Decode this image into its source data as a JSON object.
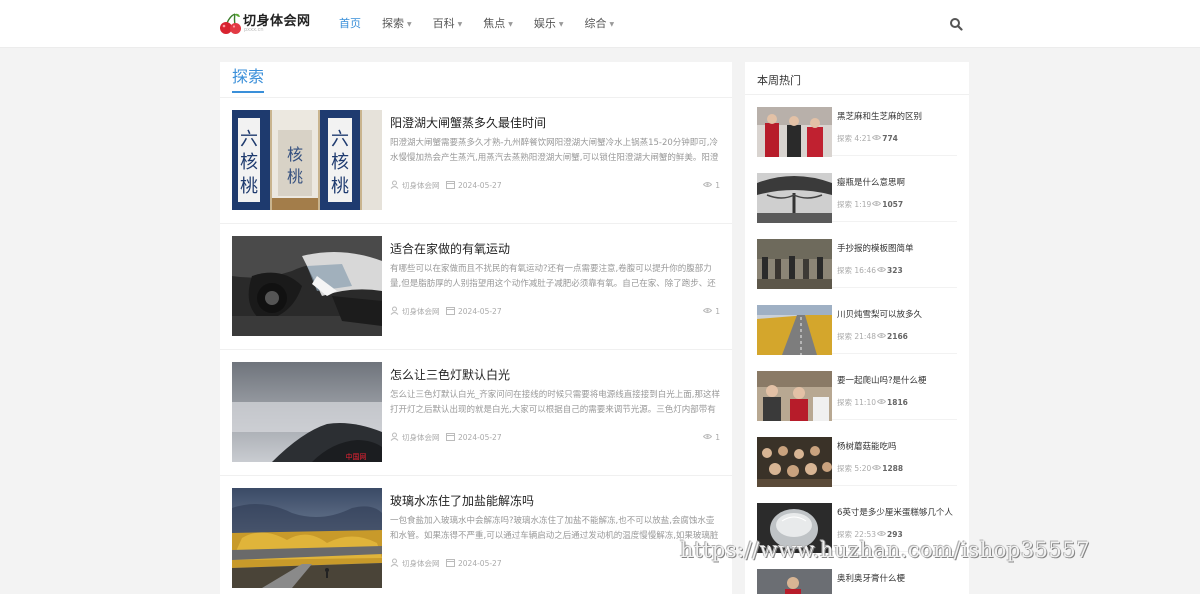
{
  "site": {
    "name": "切身体会网",
    "sub": "pxxx.cn"
  },
  "nav": {
    "items": [
      {
        "label": "首页",
        "active": true
      },
      {
        "label": "探索",
        "caret": true
      },
      {
        "label": "百科",
        "caret": true
      },
      {
        "label": "焦点",
        "caret": true
      },
      {
        "label": "娱乐",
        "caret": true
      },
      {
        "label": "综合",
        "caret": true
      }
    ],
    "search_icon": "search-icon"
  },
  "main": {
    "section_title": "探索",
    "posts": [
      {
        "title": "阳澄湖大闸蟹蒸多久最佳时间",
        "excerpt": "阳澄湖大闸蟹需要蒸多久才熟-九州醉餐饮网阳澄湖大闸蟹冷水上锅蒸15-20分钟即可,冷水慢慢加热会产生蒸汽,用蒸汽去蒸熟阳澄湖大闸蟹,可以锁住阳澄湖大闸蟹的鲜美。阳澄湖大闸蟹...",
        "author": "切身体会网",
        "date": "2024-05-27",
        "views": "1"
      },
      {
        "title": "适合在家做的有氧运动",
        "excerpt": "有哪些可以在家做而且不扰民的有氧运动?还有一点需要注意,卷腹可以提升你的腹部力量,但是脂肪厚的人别指望用这个动作减肚子减肥必须靠有氧。自己在家、除了跑步、还能做哪...",
        "author": "切身体会网",
        "date": "2024-05-27",
        "views": "1"
      },
      {
        "title": "怎么让三色灯默认白光",
        "excerpt": "怎么让三色灯默认白光_齐家问问在接线的时候只需要将电源线直接接到白光上面,那这样打开灯之后默认出现的就是白光,大家可以根据自己的需要来调节光源。三色灯内部带有分段...",
        "author": "切身体会网",
        "date": "2024-05-27",
        "views": "1"
      },
      {
        "title": "玻璃水冻住了加盐能解冻吗",
        "excerpt": "一包食盐加入玻璃水中会解冻吗?玻璃水冻住了加盐不能解冻,也不可以放盐,会腐蚀水壶和水管。如果冻得不严重,可以通过车辆启动之后通过发动机的温度慢慢解冻,如果玻璃脏了,可...",
        "author": "切身体会网",
        "date": "2024-05-27",
        "views": ""
      }
    ]
  },
  "sidebar": {
    "title": "本周热门",
    "items": [
      {
        "title": "黑芝麻和生芝麻的区别",
        "category": "探索",
        "time": "4:21",
        "views": "774"
      },
      {
        "title": "瘿瓶是什么意思啊",
        "category": "探索",
        "time": "1:19",
        "views": "1057"
      },
      {
        "title": "手抄报的模板图简单",
        "category": "探索",
        "time": "16:46",
        "views": "323"
      },
      {
        "title": "川贝炖雪梨可以放多久",
        "category": "探索",
        "time": "21:48",
        "views": "2166"
      },
      {
        "title": "要一起爬山吗?是什么梗",
        "category": "探索",
        "time": "11:10",
        "views": "1816"
      },
      {
        "title": "杨树蘑菇能吃吗",
        "category": "探索",
        "time": "5:20",
        "views": "1288"
      },
      {
        "title": "6英寸是多少厘米蛋糕够几个人",
        "category": "探索",
        "time": "22:53",
        "views": "293"
      },
      {
        "title": "奥利奥牙膏什么梗",
        "category": "",
        "time": "",
        "views": ""
      }
    ]
  },
  "watermark": "https://www.huzhan.com/ishop35557",
  "colors": {
    "accent": "#3a8fd9",
    "page_bg": "#f3f3f3"
  }
}
